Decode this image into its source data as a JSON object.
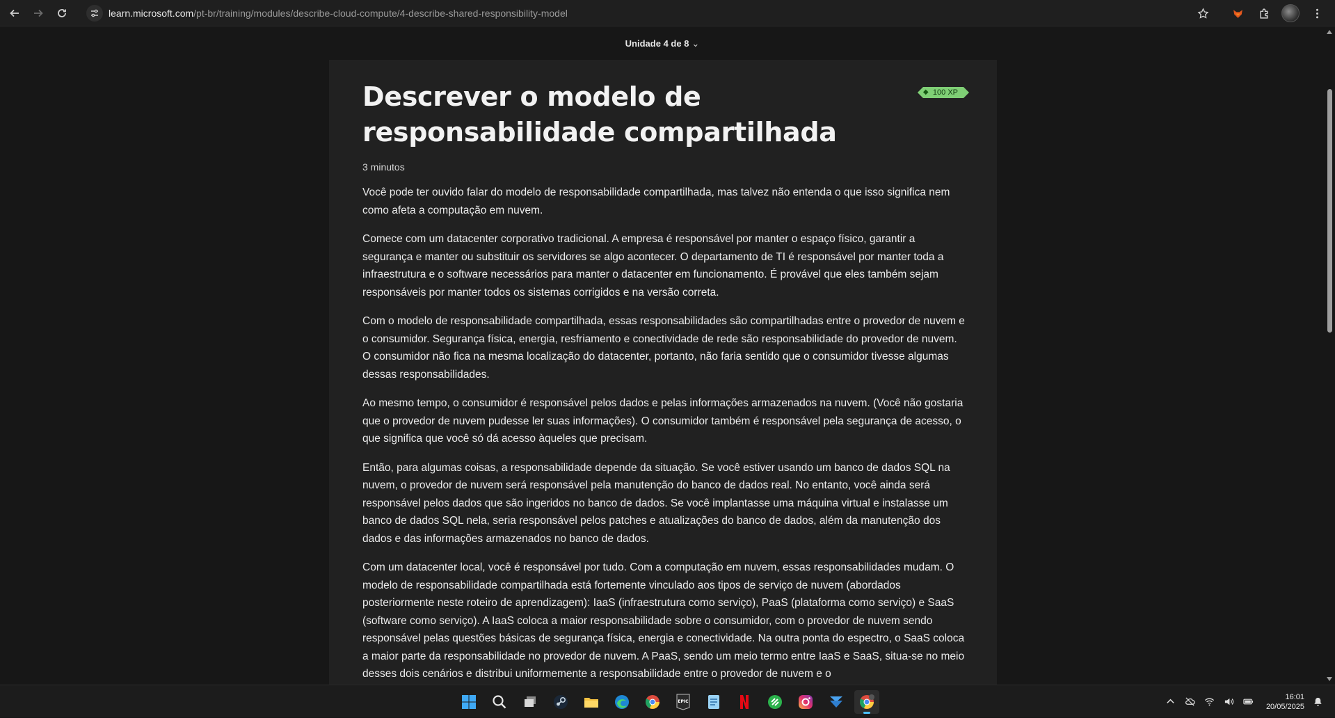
{
  "browser": {
    "url_host": "learn.microsoft.com",
    "url_path": "/pt-br/training/modules/describe-cloud-compute/4-describe-shared-responsibility-model"
  },
  "unit_nav": {
    "label": "Unidade 4 de 8"
  },
  "article": {
    "title": "Descrever o modelo de responsabilidade compartilhada",
    "xp_badge": "100 XP",
    "duration": "3 minutos",
    "paragraphs": [
      "Você pode ter ouvido falar do modelo de responsabilidade compartilhada, mas talvez não entenda o que isso significa nem como afeta a computação em nuvem.",
      "Comece com um datacenter corporativo tradicional. A empresa é responsável por manter o espaço físico, garantir a segurança e manter ou substituir os servidores se algo acontecer. O departamento de TI é responsável por manter toda a infraestrutura e o software necessários para manter o datacenter em funcionamento. É provável que eles também sejam responsáveis por manter todos os sistemas corrigidos e na versão correta.",
      "Com o modelo de responsabilidade compartilhada, essas responsabilidades são compartilhadas entre o provedor de nuvem e o consumidor. Segurança física, energia, resfriamento e conectividade de rede são responsabilidade do provedor de nuvem. O consumidor não fica na mesma localização do datacenter, portanto, não faria sentido que o consumidor tivesse algumas dessas responsabilidades.",
      "Ao mesmo tempo, o consumidor é responsável pelos dados e pelas informações armazenados na nuvem. (Você não gostaria que o provedor de nuvem pudesse ler suas informações). O consumidor também é responsável pela segurança de acesso, o que significa que você só dá acesso àqueles que precisam.",
      "Então, para algumas coisas, a responsabilidade depende da situação. Se você estiver usando um banco de dados SQL na nuvem, o provedor de nuvem será responsável pela manutenção do banco de dados real. No entanto, você ainda será responsável pelos dados que são ingeridos no banco de dados. Se você implantasse uma máquina virtual e instalasse um banco de dados SQL nela, seria responsável pelos patches e atualizações do banco de dados, além da manutenção dos dados e das informações armazenados no banco de dados.",
      "Com um datacenter local, você é responsável por tudo. Com a computação em nuvem, essas responsabilidades mudam. O modelo de responsabilidade compartilhada está fortemente vinculado aos tipos de serviço de nuvem (abordados posteriormente neste roteiro de aprendizagem): IaaS (infraestrutura como serviço), PaaS (plataforma como serviço) e SaaS (software como serviço). A IaaS coloca a maior responsabilidade sobre o consumidor, com o provedor de nuvem sendo responsável pelas questões básicas de segurança física, energia e conectividade. Na outra ponta do espectro, o SaaS coloca a maior parte da responsabilidade no provedor de nuvem. A PaaS, sendo um meio termo entre IaaS e SaaS, situa-se no meio desses dois cenários e distribui uniformemente a responsabilidade entre o provedor de nuvem e o"
    ]
  },
  "taskbar": {
    "apps": [
      "windows-start",
      "search",
      "task-view",
      "steam",
      "file-explorer",
      "edge",
      "chrome",
      "epic-games",
      "notepad",
      "netflix",
      "feedly",
      "instagram",
      "downloader",
      "chrome-active"
    ],
    "clock_time": "16:01",
    "clock_date": "20/05/2025"
  },
  "colors": {
    "page_bg": "#171717",
    "card_bg": "#212121",
    "xp_green": "#7fcf75",
    "accent_blue": "#4cc2ff"
  }
}
